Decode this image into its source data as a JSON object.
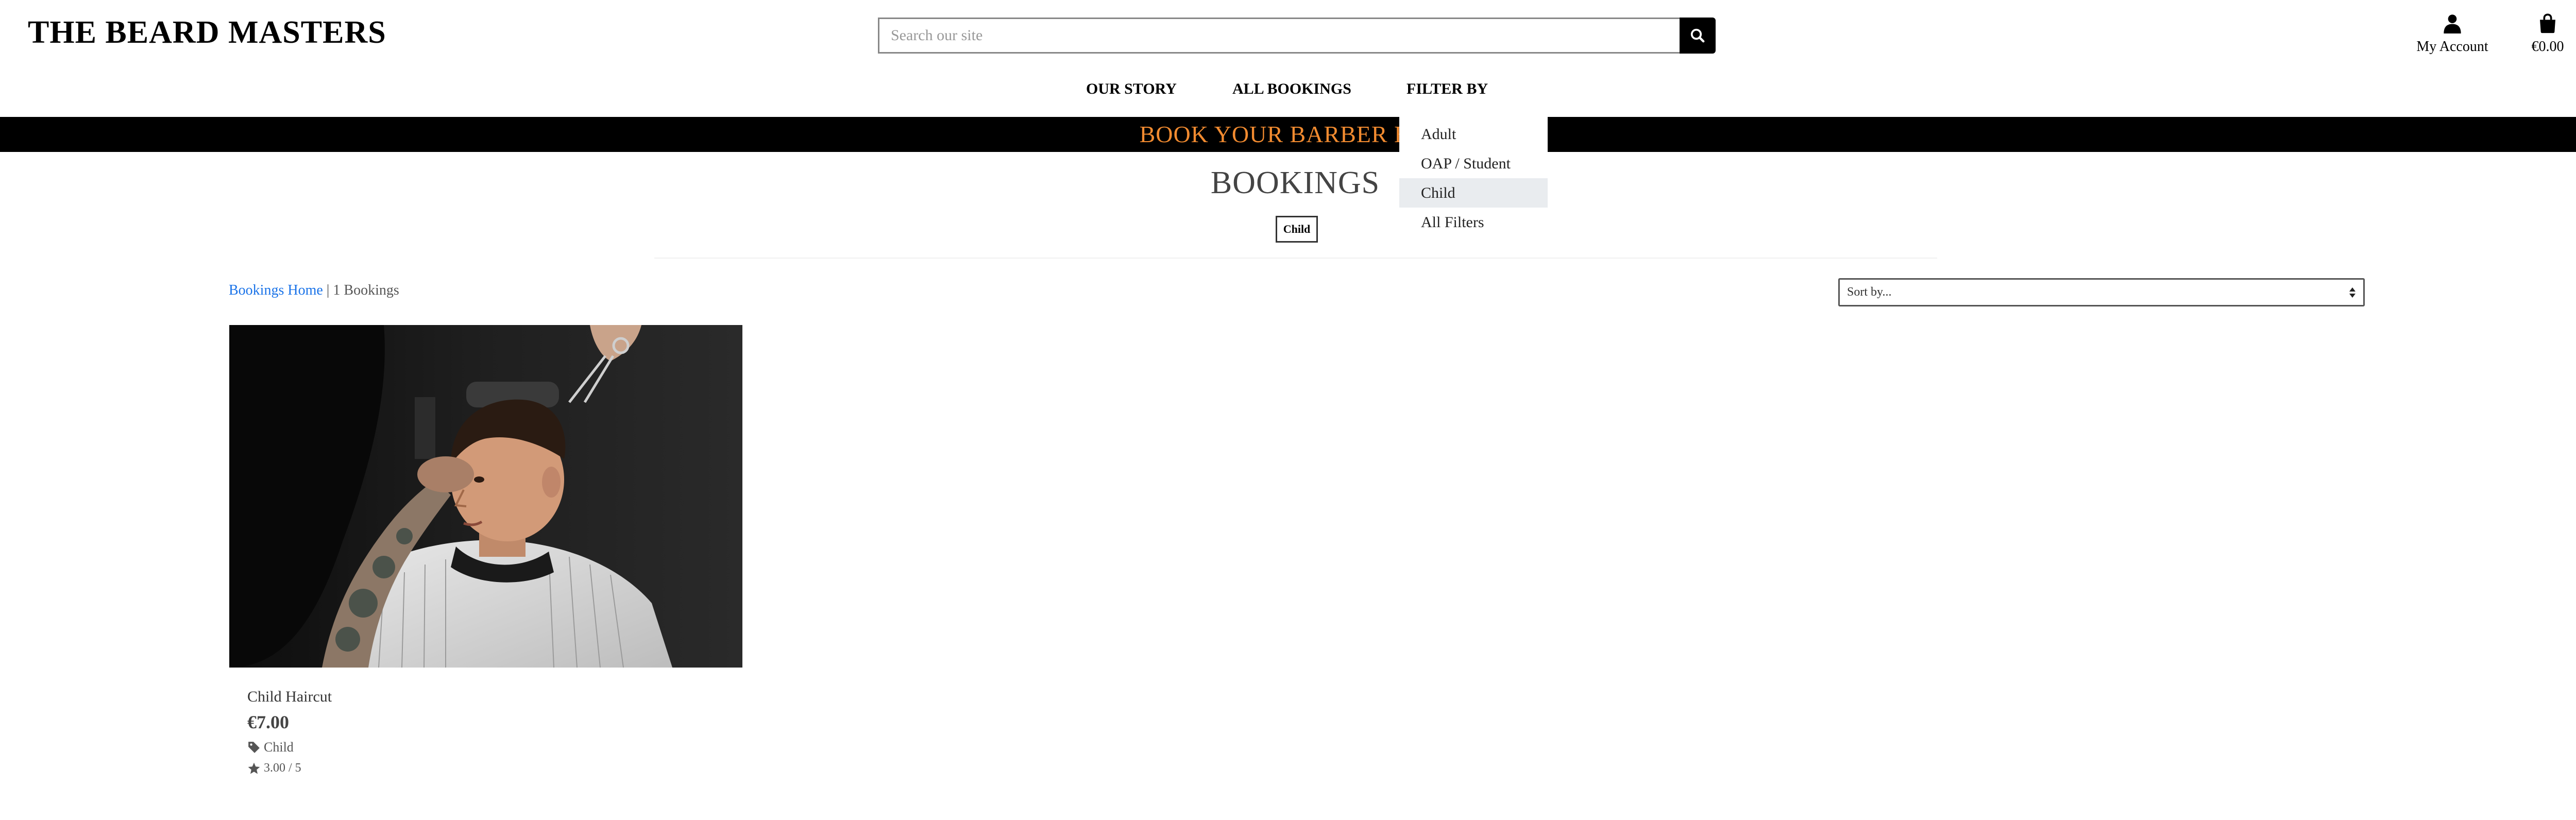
{
  "header": {
    "logo": "THE BEARD MASTERS",
    "search_placeholder": "Search our site",
    "account_label": "My Account",
    "cart_total": "€0.00"
  },
  "nav": {
    "items": [
      "OUR STORY",
      "ALL BOOKINGS",
      "FILTER BY"
    ]
  },
  "banner": {
    "text": "BOOK YOUR BARBER HOM"
  },
  "filter_dropdown": {
    "items": [
      "Adult",
      "OAP / Student",
      "Child",
      "All Filters"
    ],
    "active": "Child"
  },
  "page": {
    "title": "BOOKINGS",
    "active_filter": "Child"
  },
  "breadcrumb": {
    "home": "Bookings Home",
    "separator": " | ",
    "count": "1 Bookings"
  },
  "sort": {
    "placeholder": "Sort by..."
  },
  "products": [
    {
      "name": "Child Haircut",
      "price": "€7.00",
      "category": "Child",
      "rating": "3.00 / 5"
    }
  ],
  "colors": {
    "banner_background": "#000000",
    "banner_text": "#f28b30",
    "link": "#1a73e8",
    "dropdown_active": "#e9ecef"
  },
  "icons": {
    "search": "search-icon",
    "account": "user-icon",
    "cart": "shopping-bag-icon",
    "tag": "tag-icon",
    "rating": "star-icon"
  }
}
